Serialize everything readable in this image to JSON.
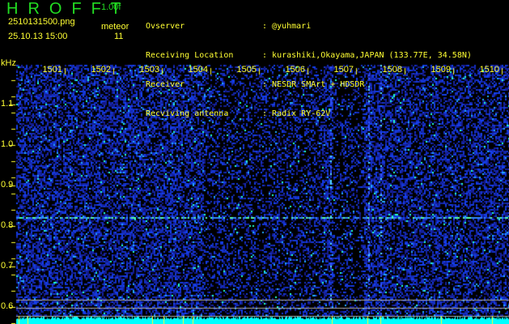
{
  "header": {
    "app_title": "HROFFT",
    "version": "1.00f",
    "filename": "2510131500.png",
    "timestamp": "25.10.13 15:00",
    "meteor_label": "meteor",
    "meteor_count": "11"
  },
  "info": [
    {
      "label": "Ovserver",
      "value": "@yuhmari"
    },
    {
      "label": "Receiving Location",
      "value": "kurashiki,Okayama,JAPAN (133.77E, 34.58N)"
    },
    {
      "label": "Receiver",
      "value": "NESDR SMArt + HDSDR"
    },
    {
      "label": "Recviving antenna",
      "value": "Radix RY-62V"
    }
  ],
  "spectrogram": {
    "y_unit": "kHz",
    "x_ticks": [
      "1501",
      "1502",
      "1503",
      "1504",
      "1505",
      "1506",
      "1507",
      "1508",
      "1509",
      "1510"
    ],
    "y_ticks": [
      "1.1",
      "1.0",
      "0.9",
      "0.8",
      "0.7",
      "0.6"
    ],
    "colors": {
      "background": "#000000",
      "noise": "#1a2aff",
      "signal": "#00ffff",
      "text": "#ffff33",
      "title": "#22dd22"
    }
  }
}
